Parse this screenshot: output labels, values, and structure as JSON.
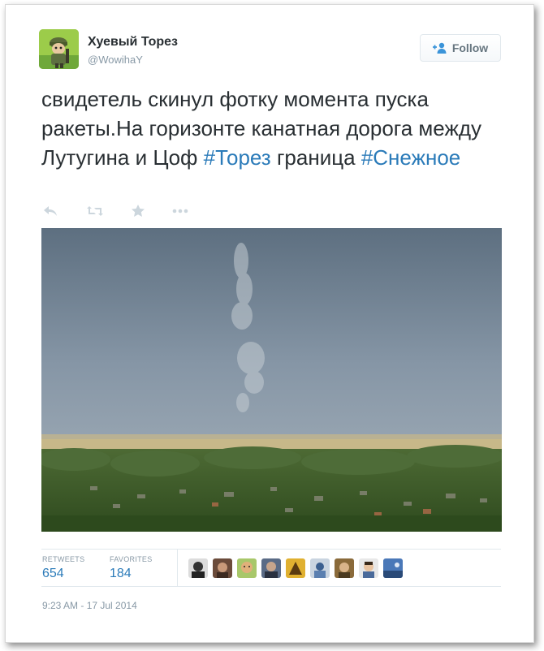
{
  "user": {
    "display_name": "Хуевый Торез",
    "screen_name": "@WowihaY",
    "avatar_icon": "cartoon-soldier-avatar"
  },
  "follow_button": {
    "label": "Follow",
    "icon": "add-user-icon"
  },
  "tweet": {
    "text_parts": [
      {
        "type": "text",
        "value": "свидетель скинул фотку момента пуска ракеты.На горизонте канатная дорога между Лутугина и Цоф "
      },
      {
        "type": "hashtag",
        "value": "#Торез"
      },
      {
        "type": "text",
        "value": " граница "
      },
      {
        "type": "hashtag",
        "value": "#Снежное"
      }
    ]
  },
  "actions": [
    "reply-icon",
    "retweet-icon",
    "favorite-icon",
    "more-icon"
  ],
  "stats": {
    "retweets_label": "RETWEETS",
    "retweets_value": "654",
    "favorites_label": "FAVORITES",
    "favorites_value": "184"
  },
  "favorited_by_count": 9,
  "timestamp": "9:23 AM - 17 Jul 2014",
  "colors": {
    "link": "#2b7bb9",
    "text": "#292f33",
    "muted": "#8899a6",
    "border": "#e1e8ed"
  }
}
